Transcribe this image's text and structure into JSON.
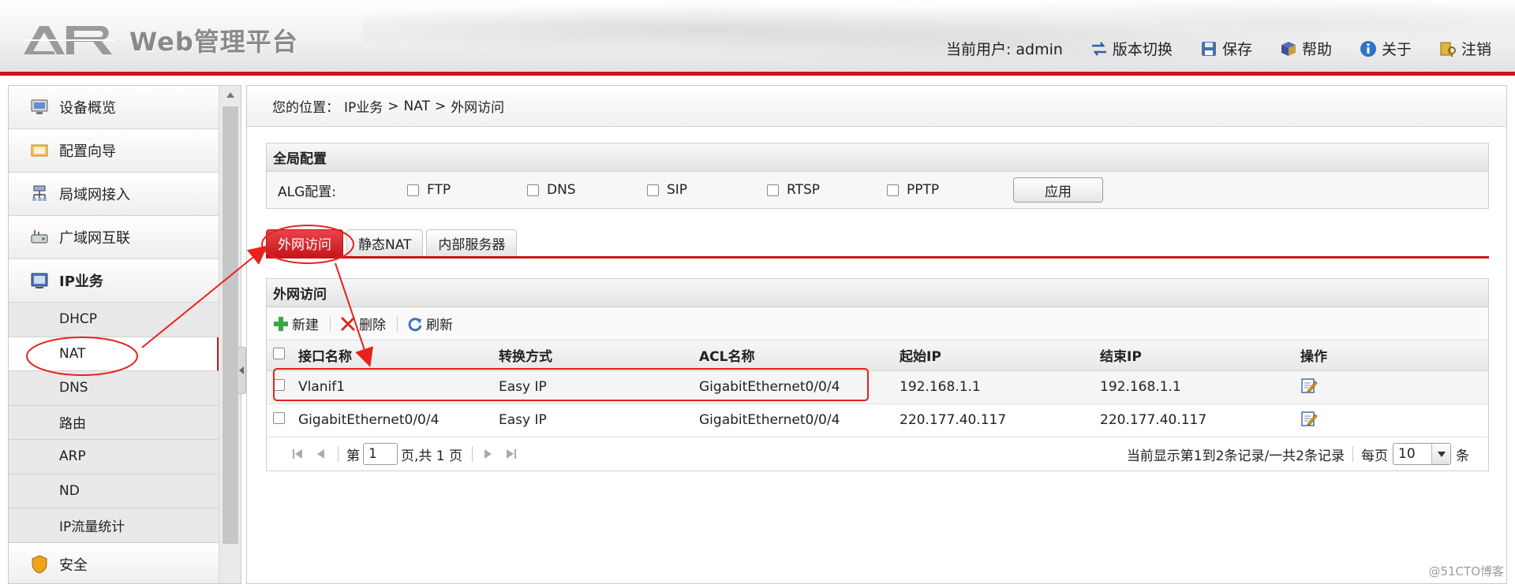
{
  "header": {
    "logo_text": "Web管理平台",
    "current_user_label": "当前用户: admin",
    "nav": {
      "version_switch": "版本切换",
      "save": "保存",
      "help": "帮助",
      "about": "关于",
      "logout": "注销"
    }
  },
  "sidebar": {
    "items": [
      {
        "label": "设备概览"
      },
      {
        "label": "配置向导"
      },
      {
        "label": "局域网接入"
      },
      {
        "label": "广域网互联"
      },
      {
        "label": "IP业务"
      }
    ],
    "sub_items": [
      {
        "label": "DHCP"
      },
      {
        "label": "NAT"
      },
      {
        "label": "DNS"
      },
      {
        "label": "路由"
      },
      {
        "label": "ARP"
      },
      {
        "label": "ND"
      },
      {
        "label": "IP流量统计"
      }
    ],
    "bottom_item": {
      "label": "安全"
    }
  },
  "breadcrumb": {
    "prefix": "您的位置：",
    "path": [
      "IP业务",
      ">",
      "NAT",
      ">",
      "外网访问"
    ]
  },
  "global_config": {
    "title": "全局配置",
    "alg_label": "ALG配置:",
    "options": [
      "FTP",
      "DNS",
      "SIP",
      "RTSP",
      "PPTP"
    ],
    "apply_label": "应用"
  },
  "tabs": [
    {
      "label": "外网访问",
      "active": true
    },
    {
      "label": "静态NAT",
      "active": false
    },
    {
      "label": "内部服务器",
      "active": false
    }
  ],
  "list_panel": {
    "title": "外网访问",
    "toolbar": {
      "new": "新建",
      "delete": "删除",
      "refresh": "刷新"
    },
    "columns": [
      "接口名称",
      "转换方式",
      "ACL名称",
      "起始IP",
      "结束IP",
      "操作"
    ],
    "rows": [
      {
        "iface": "Vlanif1",
        "mode": "Easy IP",
        "acl": "GigabitEthernet0/0/4",
        "start": "192.168.1.1",
        "end": "192.168.1.1"
      },
      {
        "iface": "GigabitEthernet0/0/4",
        "mode": "Easy IP",
        "acl": "GigabitEthernet0/0/4",
        "start": "220.177.40.117",
        "end": "220.177.40.117"
      }
    ],
    "pager": {
      "page_prefix": "第",
      "page_value": "1",
      "page_suffix": "页,共 1 页",
      "summary": "当前显示第1到2条记录/一共2条记录",
      "per_page_label": "每页",
      "per_page_value": "10",
      "per_page_suffix": "条"
    }
  },
  "watermark": "@51CTO博客",
  "colors": {
    "accent": "#c8171c",
    "annotation": "#e8211c"
  }
}
